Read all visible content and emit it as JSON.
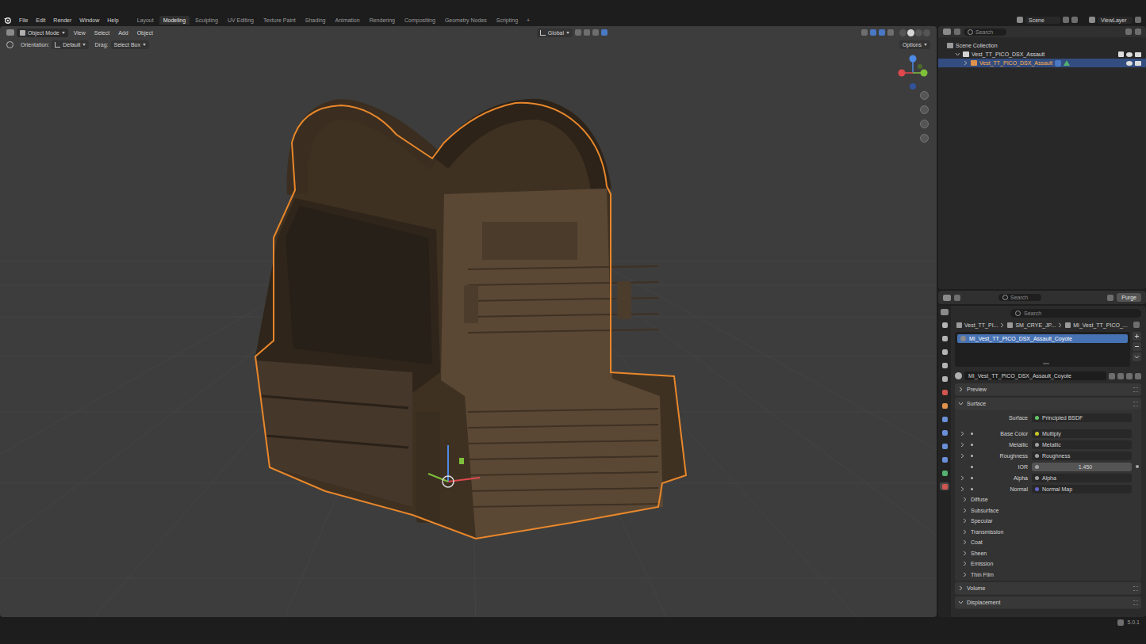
{
  "window": {
    "app": "Blender",
    "version": "5.0.1"
  },
  "menus": [
    "File",
    "Edit",
    "Render",
    "Window",
    "Help"
  ],
  "workspaces": [
    {
      "label": "Layout",
      "selected": false
    },
    {
      "label": "Modeling",
      "selected": true
    },
    {
      "label": "Sculpting",
      "selected": false
    },
    {
      "label": "UV Editing",
      "selected": false
    },
    {
      "label": "Texture Paint",
      "selected": false
    },
    {
      "label": "Shading",
      "selected": false
    },
    {
      "label": "Animation",
      "selected": false
    },
    {
      "label": "Rendering",
      "selected": false
    },
    {
      "label": "Compositing",
      "selected": false
    },
    {
      "label": "Geometry Nodes",
      "selected": false
    },
    {
      "label": "Scripting",
      "selected": false
    }
  ],
  "add_workspace": "+",
  "scene": "Scene",
  "view_layer": "ViewLayer",
  "viewport": {
    "mode": "Object Mode",
    "menus": [
      "View",
      "Select",
      "Add",
      "Object"
    ],
    "transform_orientation": "Global",
    "tool_settings": {
      "orientation_label": "Orientation:",
      "orientation_value": "Default",
      "drag_label": "Drag:",
      "drag_value": "Select Box",
      "options": "Options"
    }
  },
  "outliner": {
    "search": {
      "placeholder": "Search"
    },
    "rows": [
      {
        "label": "Scene Collection",
        "kind": "scene",
        "depth": 0,
        "expanded": true,
        "selected": false,
        "active": false,
        "checked": false,
        "visible": false,
        "renderable": false
      },
      {
        "label": "Vest_TT_PICO_DSX_Assault",
        "kind": "collection",
        "depth": 1,
        "expanded": true,
        "selected": false,
        "active": false,
        "checked": true,
        "visible": true,
        "renderable": true
      },
      {
        "label": "Vest_TT_PICO_DSX_Assault",
        "kind": "object",
        "depth": 2,
        "expanded": false,
        "selected": true,
        "active": true,
        "checked": false,
        "visible": true,
        "renderable": true
      }
    ]
  },
  "blend_file": {
    "search": {
      "placeholder": "Search"
    },
    "purge": "Purge"
  },
  "properties": {
    "search": {
      "placeholder": "Search"
    },
    "tabs": [
      {
        "color": "#b4b4b4",
        "selected": false
      },
      {
        "color": "#b4b4b4",
        "selected": false
      },
      {
        "color": "#b4b4b4",
        "selected": false
      },
      {
        "color": "#b4b4b4",
        "selected": false
      },
      {
        "color": "#b4b4b4",
        "selected": false
      },
      {
        "color": "#d0564f",
        "selected": false
      },
      {
        "color": "#e0914a",
        "selected": false
      },
      {
        "color": "#6a8fd8",
        "selected": false
      },
      {
        "color": "#6a8fd8",
        "selected": false
      },
      {
        "color": "#6a8fd8",
        "selected": false
      },
      {
        "color": "#6a8fd8",
        "selected": false
      },
      {
        "color": "#54b16f",
        "selected": false
      },
      {
        "color": "#d0564f",
        "selected": true
      }
    ],
    "breadcrumb": [
      "Vest_TT_PI...",
      "SM_CRYE_JP...",
      "MI_Vest_TT_PICO_..."
    ],
    "slots": [
      {
        "name": "MI_Vest_TT_PICO_DSX_Assault_Coyote",
        "selected": true
      }
    ],
    "material_field": "MI_Vest_TT_PICO_DSX_Assault_Coyote",
    "panels": [
      {
        "label": "Preview",
        "expanded": false,
        "inputs": [],
        "subpanels": []
      },
      {
        "label": "Surface",
        "expanded": true,
        "inputs": [
          {
            "label": "Surface",
            "value": "Principled BSDF",
            "color": "#63c763",
            "kind": "link",
            "expandable": false,
            "linked_dot": false
          },
          {
            "label": "Base Color",
            "value": "Multiply",
            "color": "#c7c729",
            "kind": "link",
            "expandable": true,
            "linked_dot": true
          },
          {
            "label": "Metallic",
            "value": "Metallic",
            "color": "#a1a1a1",
            "kind": "link",
            "expandable": true,
            "linked_dot": true
          },
          {
            "label": "Roughness",
            "value": "Roughness",
            "color": "#a1a1a1",
            "kind": "link",
            "expandable": true,
            "linked_dot": true
          },
          {
            "label": "IOR",
            "value": "1.450",
            "color": "#a1a1a1",
            "kind": "number",
            "expandable": false,
            "linked_dot": true
          },
          {
            "label": "Alpha",
            "value": "Alpha",
            "color": "#a1a1a1",
            "kind": "link",
            "expandable": true,
            "linked_dot": true
          },
          {
            "label": "Normal",
            "value": "Normal Map",
            "color": "#6363c7",
            "kind": "link",
            "expandable": true,
            "linked_dot": true
          }
        ],
        "subpanels": [
          {
            "label": "Diffuse",
            "expanded": false
          },
          {
            "label": "Subsurface",
            "expanded": false
          },
          {
            "label": "Specular",
            "expanded": false
          },
          {
            "label": "Transmission",
            "expanded": false
          },
          {
            "label": "Coat",
            "expanded": false
          },
          {
            "label": "Sheen",
            "expanded": false
          },
          {
            "label": "Emission",
            "expanded": false
          },
          {
            "label": "Thin Film",
            "expanded": false
          }
        ]
      },
      {
        "label": "Volume",
        "expanded": false,
        "inputs": [],
        "subpanels": []
      },
      {
        "label": "Displacement",
        "expanded": true,
        "inputs": [],
        "subpanels": []
      }
    ]
  }
}
